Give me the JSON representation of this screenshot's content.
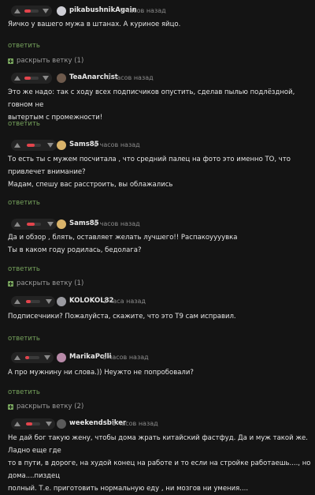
{
  "actions": {
    "reply_label": "ответить"
  },
  "comments": [
    {
      "author": "pikabushnikAgain",
      "time": "7 часов назад",
      "text": "Яичко у вашего мужа в штанах. А куриное яйцо.",
      "rating_fill": 0.45,
      "avatar_color": "#cfcfd6",
      "expand_label": "раскрыть ветку (1)"
    },
    {
      "author": "TeaAnarchist",
      "time": "7 часов назад",
      "text": "Это же надо: так с ходу всех подписчиков опустить, сделав пылью подлёздной, говном не\nвытертым с промежности!",
      "rating_fill": 0.45,
      "avatar_color": "#6e5a4c"
    },
    {
      "author": "Sams85",
      "time": "6 часов назад",
      "text": "То есть ты с мужем посчитала , что средний палец на фото это именно ТО, что\nпривлечет внимание?\nМадам, спешу вас расстроить, вы облажались",
      "rating_fill": 0.55,
      "avatar_color": "#d9b36a"
    },
    {
      "author": "Sams85",
      "time": "6 часов назад",
      "text": "Да и обзор , блять, оставляет желать лучшего!! Распакоуууувка\nТы в каком году родилась, бедолага?",
      "rating_fill": 0.55,
      "avatar_color": "#d9b36a",
      "expand_label": "раскрыть ветку (1)"
    },
    {
      "author": "KOLOKOL82",
      "time": "2 часа назад",
      "text": "Подписечники? Пожалуйста, скажите, что это Т9 сам исправил.",
      "rating_fill": 0.35,
      "avatar_color": "#9a9aa0"
    },
    {
      "author": "MarikaPolli",
      "time": "6 часов назад",
      "text": "А про мужнину ни слова.)) Неужто не попробовали?",
      "rating_fill": 0.3,
      "avatar_color": "#b88aa8",
      "expand_label": "раскрыть ветку (2)"
    },
    {
      "author": "weekendsbiker",
      "time": "6 часов назад",
      "text": "Не дай бог такую жену, чтобы дома жрать китайский фастфуд. Да и муж такой же. Ладно еще где\nто в пути, в дороге, на худой конец на работе и то если на стройке работаешь...., но дома....пиздец\nполный. Т.е. приготовить нормальную еду , ни мозгов ни умения....",
      "rating_fill": 0.45,
      "avatar_color": "#5a5a5a"
    }
  ]
}
